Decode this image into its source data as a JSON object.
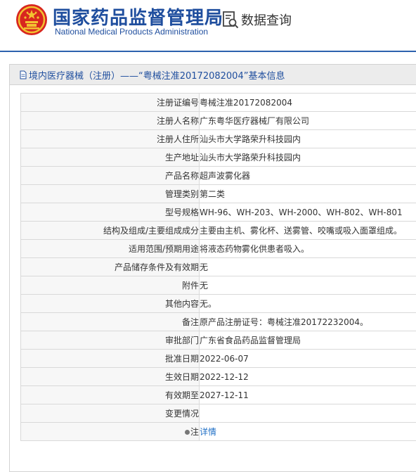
{
  "header": {
    "brand_cn": "国家药品监督管理局",
    "brand_en": "National Medical Products Administration",
    "query_label": "数据查询",
    "colors": {
      "brand": "#1f4e9e",
      "rule": "#2d62ae",
      "emblem_red": "#d8261f",
      "emblem_gold": "#f2c230"
    }
  },
  "panel": {
    "title": "境内医疗器械（注册）——“粤械注准20172082004”基本信息"
  },
  "rows": [
    {
      "label": "注册证编号",
      "value": "粤械注准20172082004"
    },
    {
      "label": "注册人名称",
      "value": "广东粤华医疗器械厂有限公司"
    },
    {
      "label": "注册人住所",
      "value": "汕头市大学路荣升科技园内"
    },
    {
      "label": "生产地址",
      "value": "汕头市大学路荣升科技园内"
    },
    {
      "label": "产品名称",
      "value": "超声波雾化器"
    },
    {
      "label": "管理类别",
      "value": "第二类"
    },
    {
      "label": "型号规格",
      "value": "WH-96、WH-203、WH-2000、WH-802、WH-801"
    },
    {
      "label": "结构及组成/主要组成成分",
      "value": "主要由主机、雾化杯、送雾管、咬嘴或吸入面罩组成。"
    },
    {
      "label": "适用范围/预期用途",
      "value": "将液态药物雾化供患者吸入。"
    },
    {
      "label": "产品储存条件及有效期",
      "value": "无"
    },
    {
      "label": "附件",
      "value": "无"
    },
    {
      "label": "其他内容",
      "value": "无。"
    },
    {
      "label": "备注",
      "value": "原产品注册证号：粤械注准20172232004。"
    },
    {
      "label": "审批部门",
      "value": "广东省食品药品监督管理局"
    },
    {
      "label": "批准日期",
      "value": "2022-06-07"
    },
    {
      "label": "生效日期",
      "value": "2022-12-12"
    },
    {
      "label": "有效期至",
      "value": "2027-12-11"
    },
    {
      "label": "变更情况",
      "value": ""
    }
  ],
  "note_row": {
    "label": "注",
    "link": "详情"
  }
}
